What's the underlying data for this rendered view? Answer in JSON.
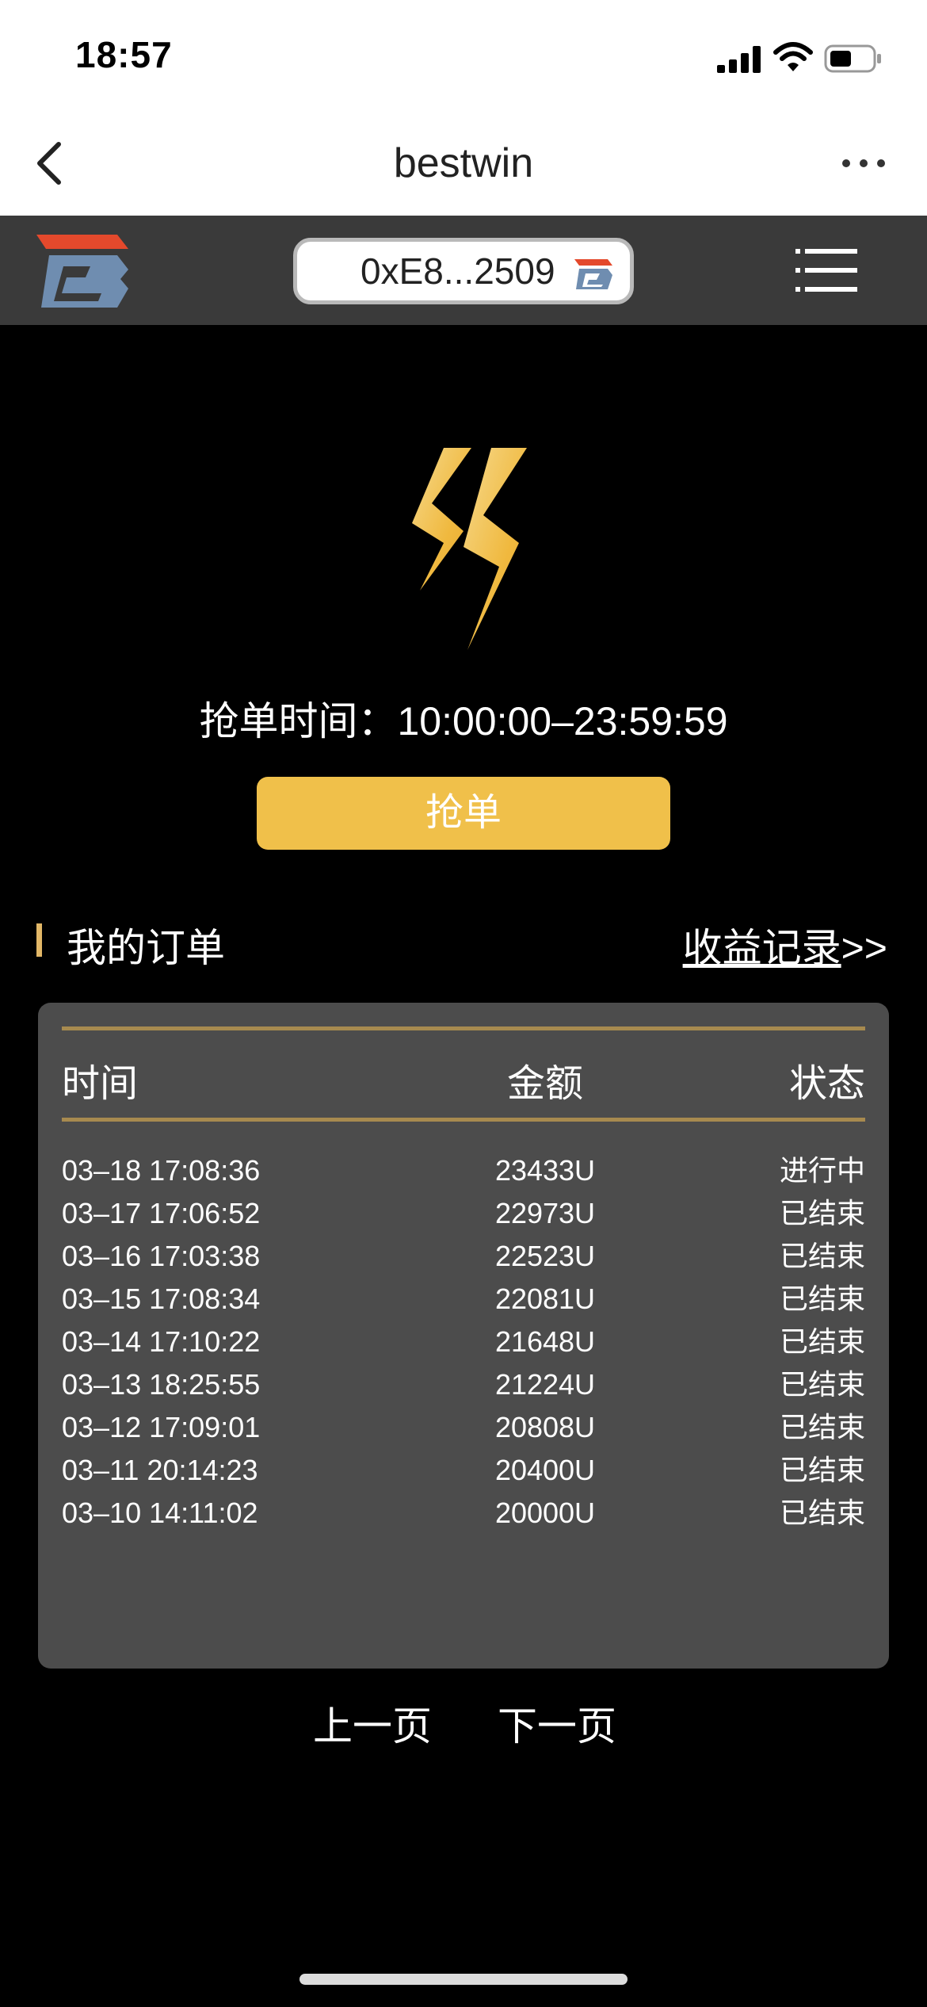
{
  "status_bar": {
    "time": "18:57"
  },
  "nav": {
    "title": "bestwin"
  },
  "header": {
    "wallet_address": "0xE8...2509"
  },
  "hero": {
    "grab_time": "抢单时间：10:00:00–23:59:59",
    "grab_button": "抢单"
  },
  "orders": {
    "title": "我的订单",
    "income_link": "收益记录",
    "income_suffix": ">>",
    "columns": {
      "time": "时间",
      "amount": "金额",
      "status": "状态"
    },
    "rows": [
      {
        "time": "03–18 17:08:36",
        "amount": "23433U",
        "status": "进行中"
      },
      {
        "time": "03–17 17:06:52",
        "amount": "22973U",
        "status": "已结束"
      },
      {
        "time": "03–16 17:03:38",
        "amount": "22523U",
        "status": "已结束"
      },
      {
        "time": "03–15 17:08:34",
        "amount": "22081U",
        "status": "已结束"
      },
      {
        "time": "03–14 17:10:22",
        "amount": "21648U",
        "status": "已结束"
      },
      {
        "time": "03–13 18:25:55",
        "amount": "21224U",
        "status": "已结束"
      },
      {
        "time": "03–12 17:09:01",
        "amount": "20808U",
        "status": "已结束"
      },
      {
        "time": "03–11 20:14:23",
        "amount": "20400U",
        "status": "已结束"
      },
      {
        "time": "03–10 14:11:02",
        "amount": "20000U",
        "status": "已结束"
      }
    ]
  },
  "pagination": {
    "prev": "上一页",
    "next": "下一页"
  },
  "colors": {
    "accent": "#f0c04a",
    "panel": "#4c4c4c",
    "rule": "#a78a4f",
    "header": "#3a3a3a"
  },
  "icons": [
    "back-icon",
    "more-icon",
    "logo",
    "menu-icon",
    "lightning-icon",
    "signal-icon",
    "wifi-icon",
    "battery-icon"
  ]
}
